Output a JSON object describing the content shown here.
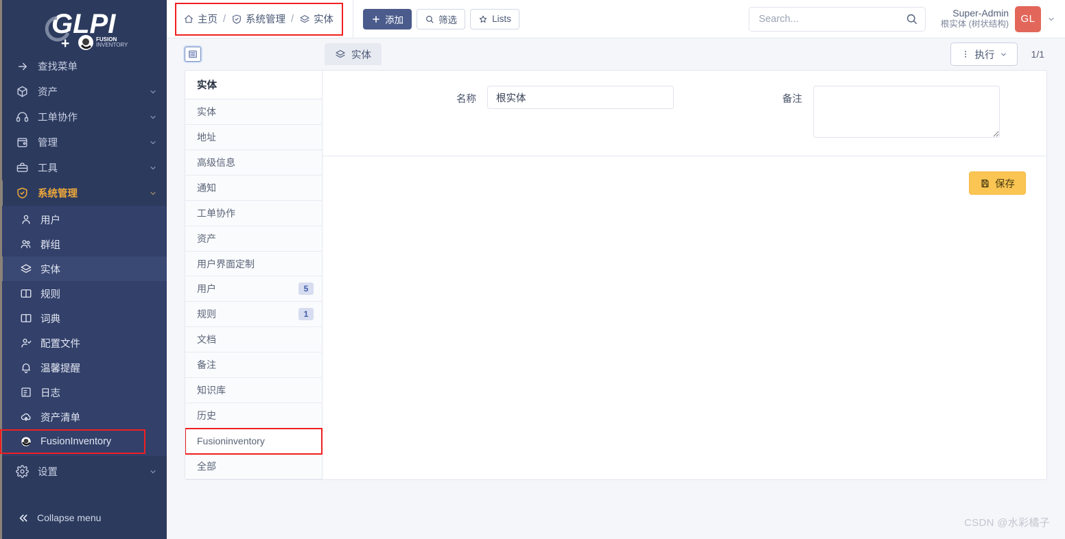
{
  "sidebar": {
    "logo": {
      "main": "GLPI",
      "plus": "+",
      "fusion_line1": "FUSION",
      "fusion_line2": "INVENTORY"
    },
    "search_menu": {
      "label": "查找菜单",
      "icon": "arrow-right-icon"
    },
    "items": [
      {
        "label": "资产",
        "icon": "box-icon",
        "chevron": true
      },
      {
        "label": "工单协作",
        "icon": "headset-icon",
        "chevron": true
      },
      {
        "label": "管理",
        "icon": "wallet-icon",
        "chevron": true
      },
      {
        "label": "工具",
        "icon": "briefcase-icon",
        "chevron": true
      },
      {
        "label": "系统管理",
        "icon": "shield-icon",
        "chevron": true,
        "open": true
      }
    ],
    "sub_items": [
      {
        "label": "用户",
        "icon": "user-icon"
      },
      {
        "label": "群组",
        "icon": "users-icon"
      },
      {
        "label": "实体",
        "icon": "layers-icon",
        "active": true
      },
      {
        "label": "规则",
        "icon": "book-icon"
      },
      {
        "label": "词典",
        "icon": "book-icon"
      },
      {
        "label": "配置文件",
        "icon": "user-check-icon"
      },
      {
        "label": "温馨提醒",
        "icon": "bell-icon"
      },
      {
        "label": "日志",
        "icon": "list-icon"
      },
      {
        "label": "资产清单",
        "icon": "cloud-upload-icon"
      },
      {
        "label": "FusionInventory",
        "icon": "fusion-icon",
        "highlight": true
      }
    ],
    "settings": {
      "label": "设置",
      "icon": "gear-icon",
      "chevron": true
    },
    "collapse": {
      "label": "Collapse menu",
      "icon": "chevrons-left-icon"
    }
  },
  "topbar": {
    "breadcrumb": [
      {
        "label": "主页",
        "icon": "home-icon"
      },
      {
        "label": "系统管理",
        "icon": "shield-icon"
      },
      {
        "label": "实体",
        "icon": "layers-icon"
      }
    ],
    "separator": "/",
    "buttons": [
      {
        "label": "添加",
        "icon": "plus-icon",
        "style": "primary"
      },
      {
        "label": "筛选",
        "icon": "search-icon",
        "style": "default"
      },
      {
        "label": "Lists",
        "icon": "star-icon",
        "style": "default"
      }
    ],
    "search": {
      "placeholder": "Search...",
      "value": "",
      "icon": "search-icon"
    },
    "user": {
      "name": "Super-Admin",
      "entity": "根实体 (树状结构)",
      "initials": "GL",
      "chevron": "chevron-down-icon"
    }
  },
  "content_toolbar": {
    "list_icon": "list-view-icon",
    "tab": {
      "label": "实体",
      "icon": "layers-icon"
    },
    "exec_button": {
      "label": "执行",
      "icon": "dots-vertical-icon",
      "chevron": "chevron-down-icon"
    },
    "page_count": "1/1"
  },
  "tab_panel": {
    "header": "实体",
    "rows": [
      {
        "label": "实体"
      },
      {
        "label": "地址"
      },
      {
        "label": "高级信息"
      },
      {
        "label": "通知"
      },
      {
        "label": "工单协作"
      },
      {
        "label": "资产"
      },
      {
        "label": "用户界面定制"
      },
      {
        "label": "用户",
        "badge": "5"
      },
      {
        "label": "规则",
        "badge": "1"
      },
      {
        "label": "文档"
      },
      {
        "label": "备注"
      },
      {
        "label": "知识库"
      },
      {
        "label": "历史"
      },
      {
        "label": "Fusioninventory",
        "highlight": true
      },
      {
        "label": "全部"
      }
    ]
  },
  "form": {
    "name": {
      "label": "名称",
      "value": "根实体"
    },
    "notes": {
      "label": "备注",
      "value": ""
    },
    "save": {
      "label": "保存",
      "icon": "save-icon"
    }
  },
  "watermark": "CSDN @水彩橘子",
  "colors": {
    "sidebar_bg": "#2c3a5e",
    "sidebar_sub_bg": "#32406a",
    "accent_orange": "#f0a93b",
    "highlight_red": "#f01f1f",
    "primary_button": "#4a5b8c",
    "save_button": "#fac552",
    "avatar": "#e2675a",
    "badge_bg": "#d7ddf0",
    "badge_text": "#3f5da8"
  }
}
